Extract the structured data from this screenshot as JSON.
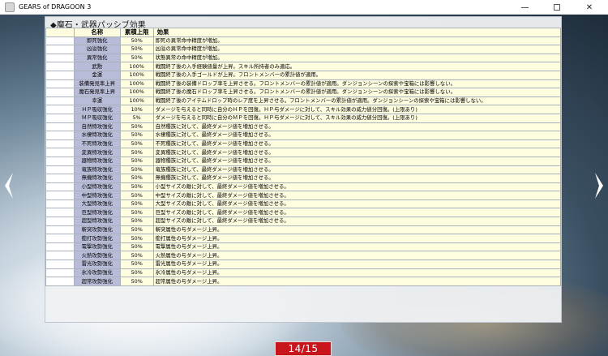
{
  "window": {
    "title": "GEARS of DRAGOON 3",
    "minimize_icon": "minimize-icon",
    "maximize_icon": "maximize-icon",
    "close_icon": "close-icon"
  },
  "panel": {
    "heading": "◆魔石・武器パッシブ効果",
    "columns": [
      "名称",
      "累積上限",
      "効果"
    ],
    "rows": [
      {
        "name": "即死強化",
        "limit": "50%",
        "effect": "即死の異常命中精度が増加。"
      },
      {
        "name": "凶溢強化",
        "limit": "50%",
        "effect": "凶溢の異常命中精度が増加。"
      },
      {
        "name": "異常強化",
        "limit": "50%",
        "effect": "状態異常の命中精度が増加。"
      },
      {
        "name": "武勲",
        "limit": "100%",
        "effect": "戦闘終了後の入手経験値量が上昇。スキル所持者のみ適応。"
      },
      {
        "name": "金運",
        "limit": "100%",
        "effect": "戦闘終了後の入手ゴールドが上昇。フロントメンバーの累計値が適用。"
      },
      {
        "name": "装備発見率上昇",
        "limit": "100%",
        "effect": "戦闘終了後の装備ドロップ率を上昇させる。フロントメンバーの累計値が適用。ダンジョンシーンの探索や宝箱には影響しない。"
      },
      {
        "name": "魔石発見率上昇",
        "limit": "100%",
        "effect": "戦闘終了後の魔石ドロップ率を上昇させる。フロントメンバーの累計値が適用。ダンジョンシーンの探索や宝箱には影響しない。"
      },
      {
        "name": "幸運",
        "limit": "100%",
        "effect": "戦闘終了後のアイテムドロップ時のレア度を上昇させる。フロントメンバーの累計値が適用。ダンジョンシーンの探索や宝箱には影響しない。"
      },
      {
        "name": "ＨＰ吸収強化",
        "limit": "10%",
        "effect": "ダメージを与えると同時に自分のＨＰを回復。ＨＰ与ダメージに対して、スキル効果の威力値分回復。(上限あり)"
      },
      {
        "name": "ＭＰ吸収強化",
        "limit": "5%",
        "effect": "ダメージを与えると同時に自分のＭＰを回復。ＨＰ与ダメージに対して、スキル効果の威力値分回復。(上限あり)"
      },
      {
        "name": "自然特攻強化",
        "limit": "50%",
        "effect": "自然種族に対して、最終ダメージ値を増加させる。"
      },
      {
        "name": "水棲特攻強化",
        "limit": "50%",
        "effect": "水棲種族に対して、最終ダメージ値を増加させる。"
      },
      {
        "name": "不死特攻強化",
        "limit": "50%",
        "effect": "不死種族に対して、最終ダメージ値を増加させる。"
      },
      {
        "name": "変異特攻強化",
        "limit": "50%",
        "effect": "変異種族に対して、最終ダメージ値を増加させる。"
      },
      {
        "name": "器物特攻強化",
        "limit": "50%",
        "effect": "器物種族に対して、最終ダメージ値を増加させる。"
      },
      {
        "name": "竜族特攻強化",
        "limit": "50%",
        "effect": "竜族種族に対して、最終ダメージ値を増加させる。"
      },
      {
        "name": "無機特攻強化",
        "limit": "50%",
        "effect": "無機種族に対して、最終ダメージ値を増加させる。"
      },
      {
        "name": "小型特攻強化",
        "limit": "50%",
        "effect": "小型サイズの敵に対して、最終ダメージ値を増加させる。"
      },
      {
        "name": "中型特攻強化",
        "limit": "50%",
        "effect": "中型サイズの敵に対して、最終ダメージ値を増加させる。"
      },
      {
        "name": "大型特攻強化",
        "limit": "50%",
        "effect": "大型サイズの敵に対して、最終ダメージ値を増加させる。"
      },
      {
        "name": "巨型特攻強化",
        "limit": "50%",
        "effect": "巨型サイズの敵に対して、最終ダメージ値を増加させる。"
      },
      {
        "name": "超型特攻強化",
        "limit": "50%",
        "effect": "超型サイズの敵に対して、最終ダメージ値を増加させる。"
      },
      {
        "name": "斬突攻勢強化",
        "limit": "50%",
        "effect": "斬突属性の与ダメージ上昇。"
      },
      {
        "name": "衝打攻勢強化",
        "limit": "50%",
        "effect": "衝打属性の与ダメージ上昇。"
      },
      {
        "name": "電撃攻勢強化",
        "limit": "50%",
        "effect": "電撃属性の与ダメージ上昇。"
      },
      {
        "name": "火熱攻勢強化",
        "limit": "50%",
        "effect": "火熱属性の与ダメージ上昇。"
      },
      {
        "name": "雷光攻勢強化",
        "limit": "50%",
        "effect": "雷光属性の与ダメージ上昇。"
      },
      {
        "name": "氷冷攻勢強化",
        "limit": "50%",
        "effect": "氷冷属性の与ダメージ上昇。"
      },
      {
        "name": "超常攻勢強化",
        "limit": "50%",
        "effect": "超常属性の与ダメージ上昇。"
      }
    ]
  },
  "navigation": {
    "prev_icon": "chevron-left-icon",
    "next_icon": "chevron-right-icon",
    "page_indicator": "14/15"
  }
}
